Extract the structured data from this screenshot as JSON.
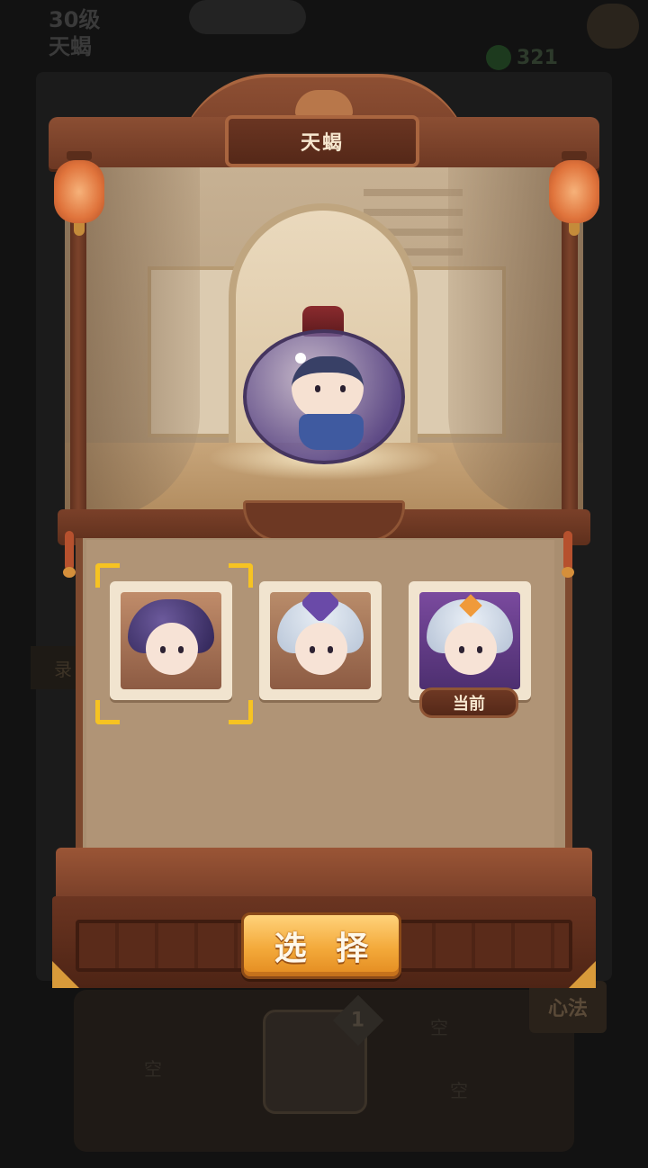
{
  "background": {
    "level": "30级",
    "name": "天蝎",
    "count": "321",
    "left_tab": "录",
    "xinfa_label": "心法",
    "slot_number": "1",
    "empty_slot": "空"
  },
  "dialog": {
    "title": "天蝎",
    "cards": [
      {
        "selected": true,
        "is_current": false,
        "theme": "bottle-pet"
      },
      {
        "selected": false,
        "is_current": false,
        "theme": "purple-hat"
      },
      {
        "selected": false,
        "is_current": true,
        "theme": "crown"
      }
    ],
    "current_label": "当前",
    "select_button": "选 择"
  },
  "colors": {
    "selection_corner": "#f6c322",
    "button_gold": "#f3a93a",
    "wood": "#6d3823"
  }
}
